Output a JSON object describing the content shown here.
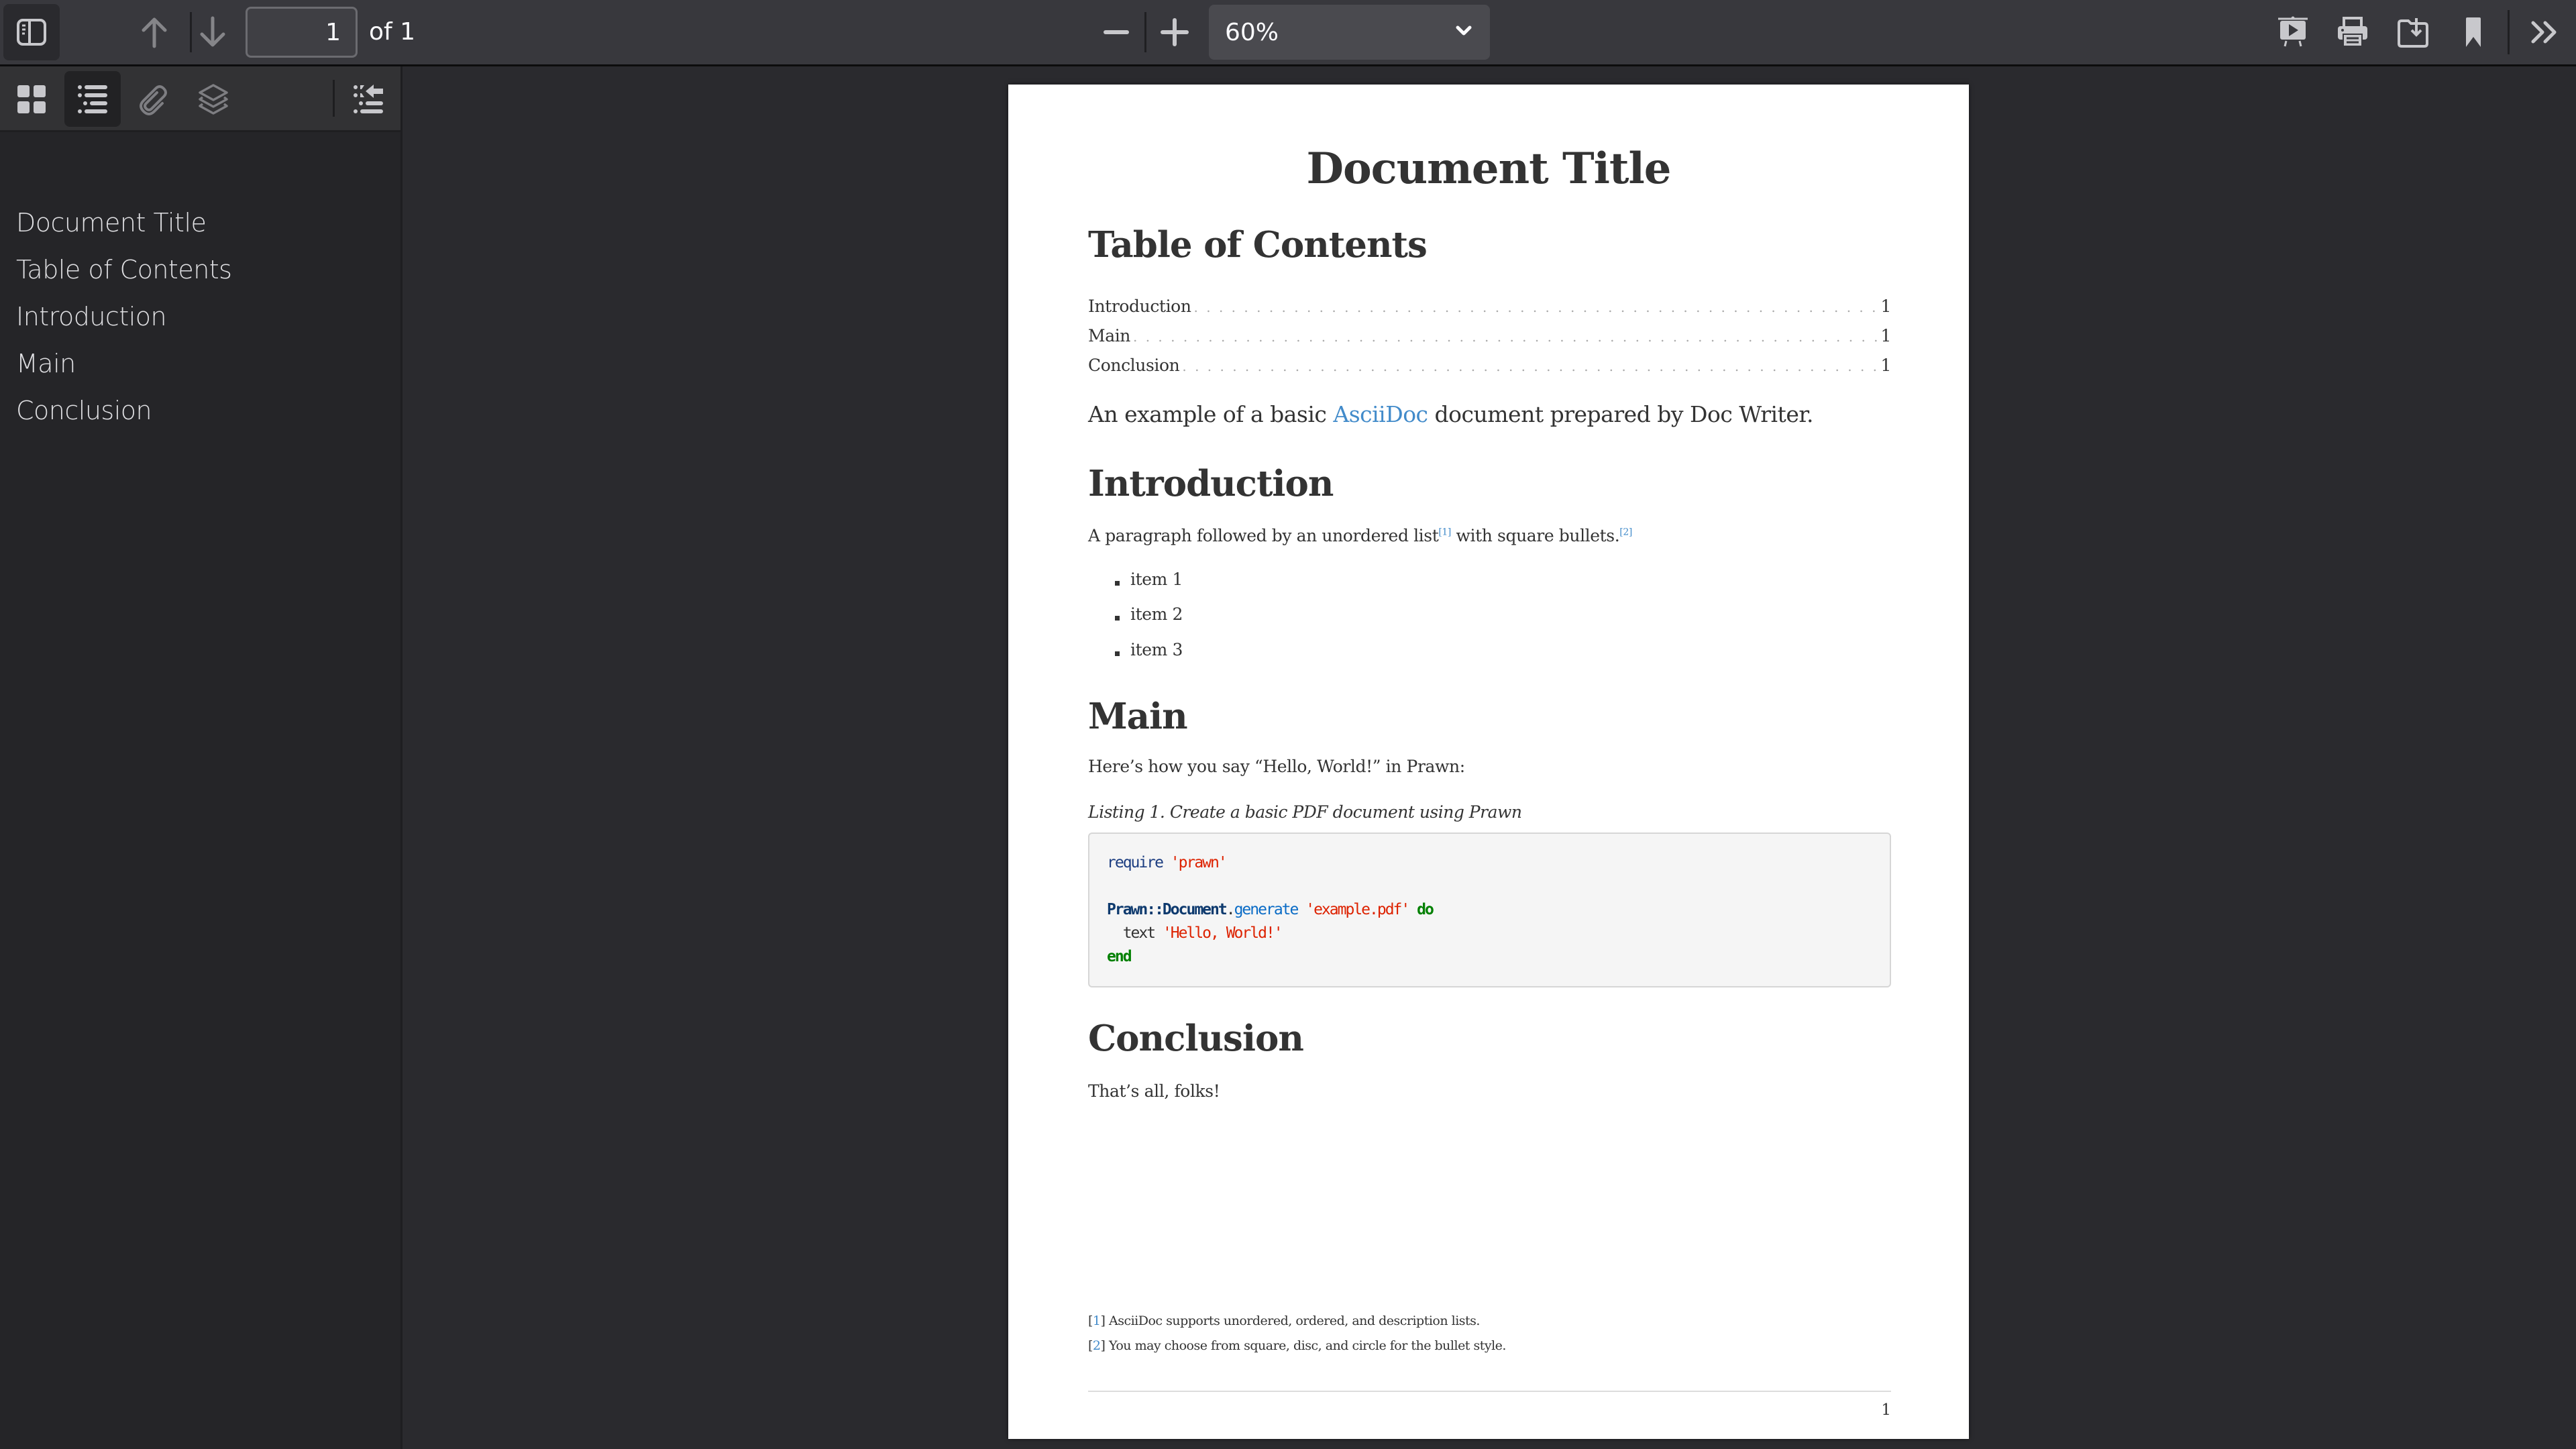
{
  "toolbar": {
    "sidebar_toggle": "sidebar-toggle-icon",
    "prev_page": "arrow-up-icon",
    "next_page": "arrow-down-icon",
    "page_number": "1",
    "page_count_label": "of 1",
    "zoom_out": "minus-icon",
    "zoom_in": "plus-icon",
    "zoom_value": "60%",
    "right_icons": [
      "presentation-mode-icon",
      "print-icon",
      "save-icon",
      "bookmark-icon",
      "tools-chevrons-icon"
    ]
  },
  "sidebar": {
    "views": [
      {
        "name": "thumbnails",
        "icon": "grid-icon",
        "active": false
      },
      {
        "name": "outline",
        "icon": "list-icon",
        "active": true
      },
      {
        "name": "attachments",
        "icon": "paperclip-icon",
        "active": false
      },
      {
        "name": "layers",
        "icon": "layers-icon",
        "active": false
      }
    ],
    "collapse_icon": "collapse-outline-icon",
    "outline": [
      "Document Title",
      "Table of Contents",
      "Introduction",
      "Main",
      "Conclusion"
    ]
  },
  "document": {
    "title": "Document Title",
    "toc_heading": "Table of Contents",
    "toc": [
      {
        "label": "Introduction",
        "page": "1"
      },
      {
        "label": "Main",
        "page": "1"
      },
      {
        "label": "Conclusion",
        "page": "1"
      }
    ],
    "lead": {
      "before": "An example of a basic ",
      "link": "AsciiDoc",
      "after": " document prepared by Doc Writer."
    },
    "intro": {
      "heading": "Introduction",
      "para_a": "A paragraph followed by an unordered list",
      "fn1": "[1]",
      "para_b": " with square bullets.",
      "fn2": "[2]",
      "items": [
        "item 1",
        "item 2",
        "item 3"
      ]
    },
    "main": {
      "heading": "Main",
      "para": "Here’s how you say “Hello, World!” in Prawn:",
      "caption": "Listing 1. Create a basic PDF document using Prawn",
      "code": {
        "l1_kw": "require",
        "l1_str": "'prawn'",
        "l3_cls": "Prawn::Document",
        "l3_dot": ".",
        "l3_meth": "generate",
        "l3_str": "'example.pdf'",
        "l3_kw": "do",
        "l4_text": "  text ",
        "l4_str": "'Hello, World!'",
        "l5_kw": "end"
      }
    },
    "conclusion": {
      "heading": "Conclusion",
      "para": "That’s all, folks!"
    },
    "footnotes": [
      {
        "open": "[",
        "num": "1",
        "close": "]",
        "text": " AsciiDoc supports unordered, ordered, and description lists."
      },
      {
        "open": "[",
        "num": "2",
        "close": "]",
        "text": " You may choose from square, disc, and circle for the bullet style."
      }
    ],
    "page_number": "1"
  },
  "colors": {
    "toolbar_bg": "#38383d",
    "sidebar_bg": "#252528",
    "viewer_bg": "#2a2a2e",
    "link": "#428bca",
    "text": "#333333"
  }
}
